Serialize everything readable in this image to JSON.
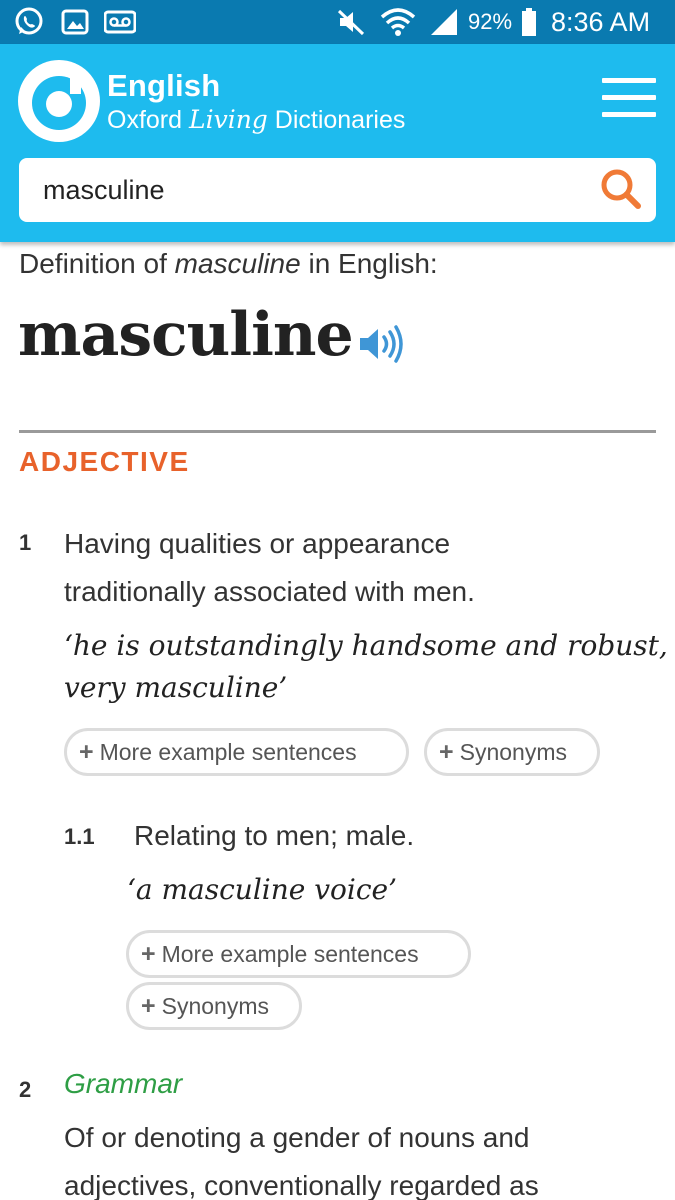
{
  "status_bar": {
    "icons": [
      "whatsapp-icon",
      "gallery-icon",
      "voicemail-icon",
      "mute-icon",
      "wifi-icon",
      "signal-icon",
      "battery-icon"
    ],
    "battery": "92%",
    "time": "8:36 AM"
  },
  "header": {
    "brand_top": "English",
    "brand_sub_pre": "Oxford ",
    "brand_sub_living": "Living",
    "brand_sub_post": " Dictionaries",
    "menu_icon": "hamburger-menu-icon"
  },
  "search": {
    "value": "masculine",
    "icon": "search-icon"
  },
  "entry": {
    "definition_of_pre": "Definition of ",
    "definition_of_word": "masculine",
    "definition_of_post": " in English:",
    "headword": "masculine",
    "audio_icon": "speaker-icon",
    "part_of_speech": "ADJECTIVE",
    "senses": [
      {
        "number": "1",
        "definition_line1": "Having qualities or appearance",
        "definition_line2": "traditionally associated with men.",
        "example_line1": "‘he is outstandingly handsome and robust,",
        "example_line2": "very masculine’",
        "more_examples": "More example sentences",
        "synonyms": "Synonyms"
      }
    ],
    "subsenses": [
      {
        "number": "1.1",
        "definition": "Relating to men; male.",
        "example": "‘a masculine voice’",
        "more_examples": "More example sentences",
        "synonyms": "Synonyms"
      }
    ],
    "sense2": {
      "number": "2",
      "label": "Grammar",
      "definition_line1": "Of or denoting a gender of nouns and",
      "definition_line2": "adjectives, conventionally regarded as"
    },
    "plus": "+"
  },
  "colors": {
    "header_bg": "#1ebbee",
    "status_bg": "#0a7ab0",
    "accent_orange": "#e8622b",
    "grammar_green": "#2e9e45"
  }
}
